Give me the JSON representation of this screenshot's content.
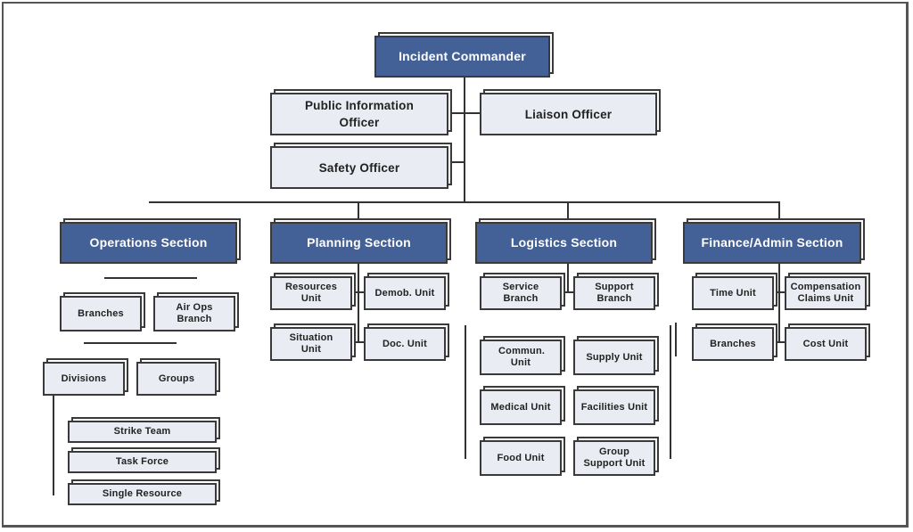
{
  "command": {
    "incident_commander": "Incident Commander",
    "public_information_officer": "Public Information Officer",
    "liaison_officer": "Liaison Officer",
    "safety_officer": "Safety Officer"
  },
  "sections": {
    "operations": {
      "title": "Operations Section",
      "branches": "Branches",
      "air_ops_branch": "Air Ops Branch",
      "divisions": "Divisions",
      "groups": "Groups",
      "strike_team": "Strike Team",
      "task_force": "Task Force",
      "single_resource": "Single Resource"
    },
    "planning": {
      "title": "Planning Section",
      "resources_unit": "Resources Unit",
      "demob_unit": "Demob. Unit",
      "situation_unit": "Situation Unit",
      "doc_unit": "Doc. Unit"
    },
    "logistics": {
      "title": "Logistics Section",
      "service_branch": "Service Branch",
      "support_branch": "Support Branch",
      "commun_unit": "Commun. Unit",
      "supply_unit": "Supply Unit",
      "medical_unit": "Medical Unit",
      "facilities_unit": "Facilities Unit",
      "food_unit": "Food Unit",
      "group_support_unit": "Group Support Unit"
    },
    "finance": {
      "title": "Finance/Admin Section",
      "time_unit": "Time Unit",
      "compensation_claims_unit": "Compensation Claims Unit",
      "branches": "Branches",
      "cost_unit": "Cost Unit"
    }
  },
  "colors": {
    "section_fill": "#436197",
    "unit_fill": "#e9ecf2",
    "outline": "#3a3a3a"
  }
}
